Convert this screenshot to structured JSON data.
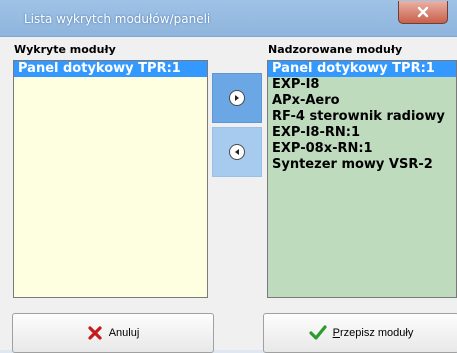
{
  "window": {
    "title": "Lista wykrytch modułów/paneli",
    "close_symbol": "×"
  },
  "left": {
    "label": "Wykryte moduły",
    "items": [
      "Panel dotykowy TPR:1"
    ],
    "selected_index": 0
  },
  "right": {
    "label": "Nadzorowane moduły",
    "items": [
      "Panel dotykowy TPR:1",
      "EXP-I8",
      "APx-Aero",
      "RF-4 sterownik radiowy",
      "EXP-I8-RN:1",
      "EXP-08x-RN:1",
      "Syntezer mowy VSR-2"
    ],
    "selected_index": 0
  },
  "buttons": {
    "move_right_icon": "arrow-right-circle-icon",
    "move_left_icon": "arrow-left-circle-icon",
    "cancel_label": "Anuluj",
    "cancel_icon": "red-x-icon",
    "assign_label": "Przepisz moduły",
    "assign_icon": "green-check-icon"
  },
  "colors": {
    "left_list_bg": "#fefee0",
    "right_list_bg": "#bedbbd",
    "selection": "#3399ff",
    "titlebar": "#9fc2e6"
  }
}
